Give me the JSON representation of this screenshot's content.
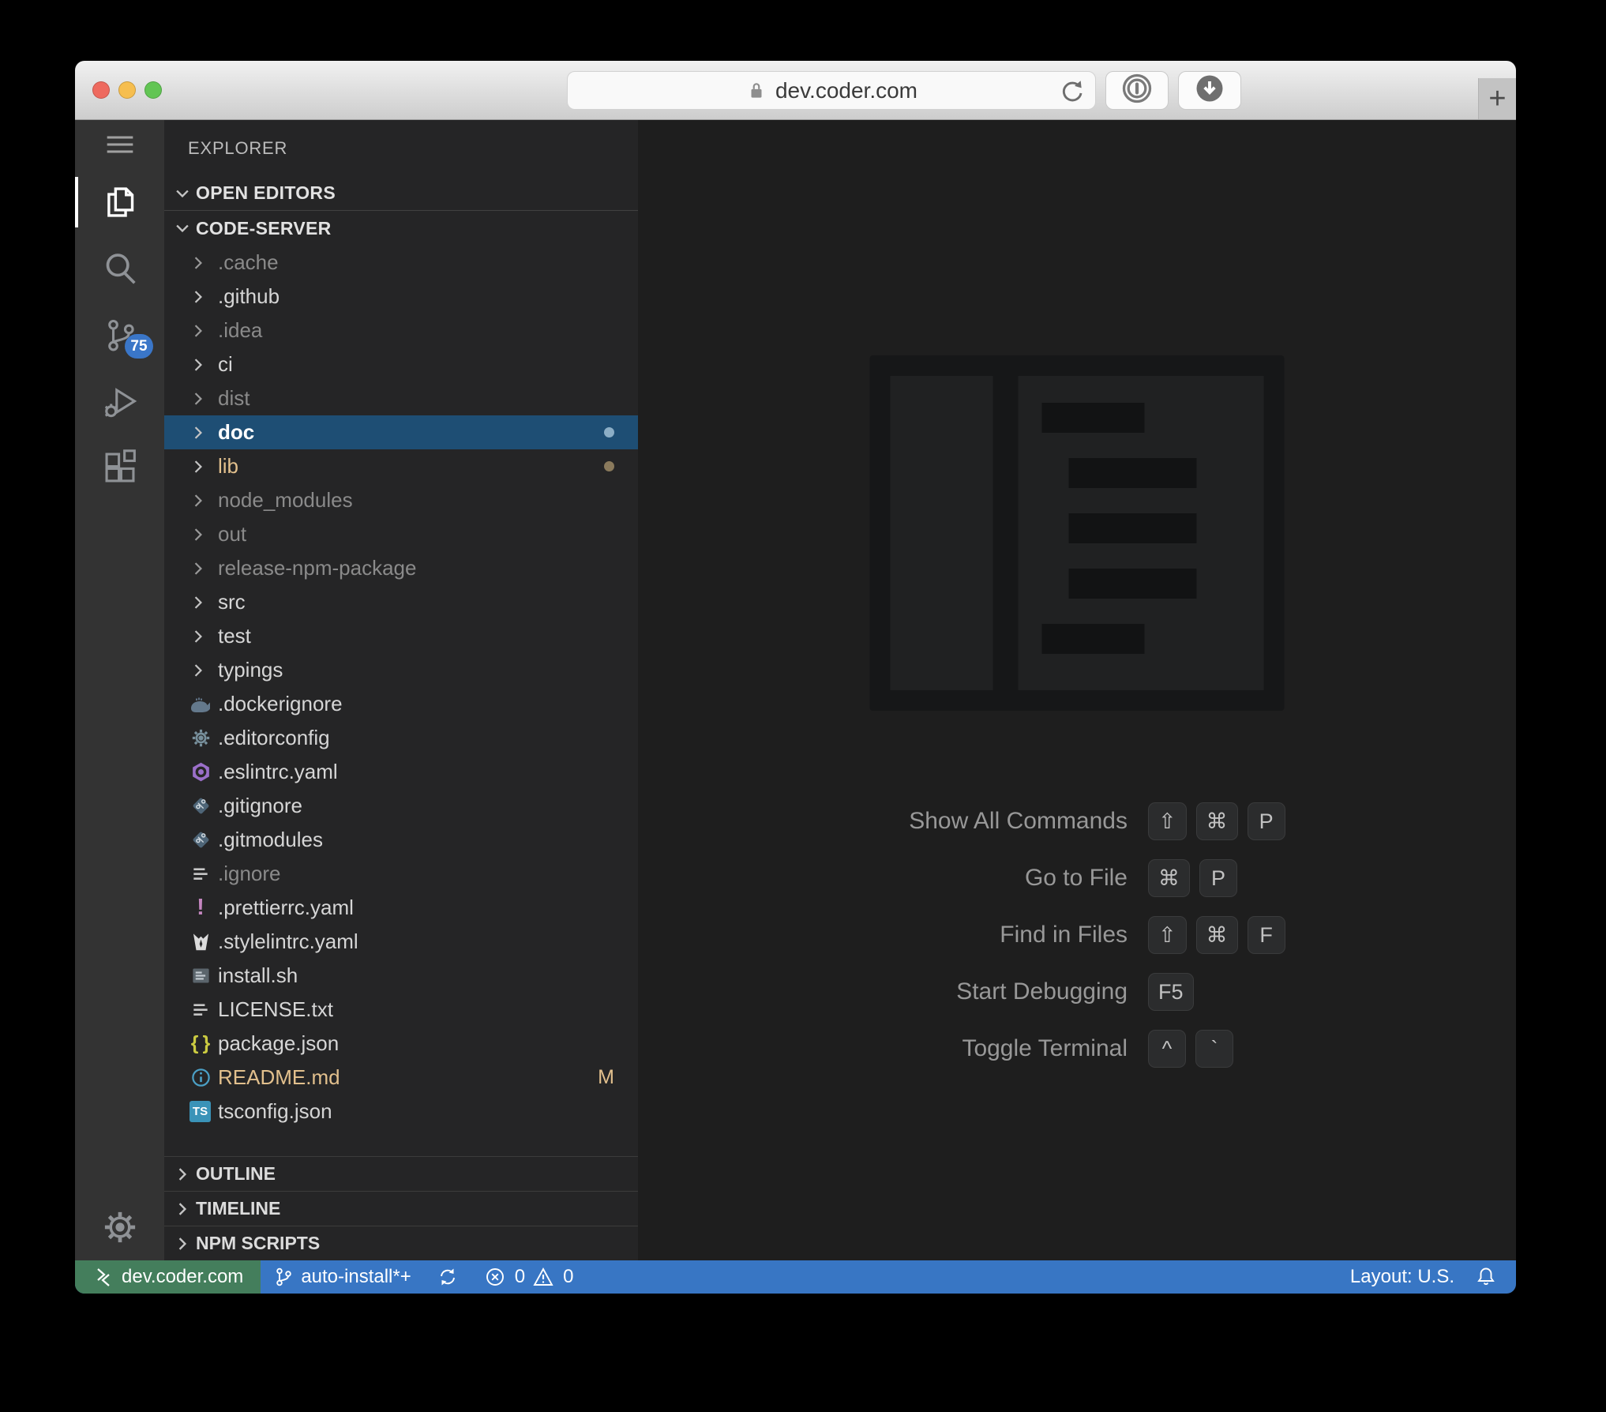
{
  "browser": {
    "url": "dev.coder.com",
    "new_tab_label": "+",
    "traffic_lights": [
      "close",
      "minimize",
      "zoom"
    ],
    "icons": {
      "lock-icon": "padlock",
      "reload-icon": "circular-arrow",
      "onepassword-icon": "1password-keyhole",
      "download-icon": "down-arrow-in-circle",
      "new-tab-icon": "plus"
    }
  },
  "activity_bar": {
    "scm_badge": "75",
    "icons": [
      "menu-icon",
      "files-icon",
      "search-icon",
      "source-control-icon",
      "debug-icon",
      "extensions-icon",
      "gear-icon"
    ]
  },
  "explorer": {
    "title": "EXPLORER",
    "open_editors_label": "OPEN EDITORS",
    "root_label": "CODE-SERVER",
    "items": [
      {
        "name": ".cache",
        "type": "folder",
        "state": "ignored"
      },
      {
        "name": ".github",
        "type": "folder",
        "state": "normal"
      },
      {
        "name": ".idea",
        "type": "folder",
        "state": "ignored"
      },
      {
        "name": "ci",
        "type": "folder",
        "state": "normal"
      },
      {
        "name": "dist",
        "type": "folder",
        "state": "ignored"
      },
      {
        "name": "doc",
        "type": "folder",
        "state": "selected",
        "dot": "blue-gray"
      },
      {
        "name": "lib",
        "type": "folder",
        "state": "modified",
        "dot": "tan"
      },
      {
        "name": "node_modules",
        "type": "folder",
        "state": "ignored"
      },
      {
        "name": "out",
        "type": "folder",
        "state": "ignored"
      },
      {
        "name": "release-npm-package",
        "type": "folder",
        "state": "ignored"
      },
      {
        "name": "src",
        "type": "folder",
        "state": "normal"
      },
      {
        "name": "test",
        "type": "folder",
        "state": "normal"
      },
      {
        "name": "typings",
        "type": "folder",
        "state": "normal"
      },
      {
        "name": ".dockerignore",
        "type": "file",
        "icon": "docker-whale-icon",
        "state": "normal"
      },
      {
        "name": ".editorconfig",
        "type": "file",
        "icon": "gear-file-icon",
        "state": "normal"
      },
      {
        "name": ".eslintrc.yaml",
        "type": "file",
        "icon": "eslint-icon",
        "state": "normal"
      },
      {
        "name": ".gitignore",
        "type": "file",
        "icon": "git-icon",
        "state": "normal"
      },
      {
        "name": ".gitmodules",
        "type": "file",
        "icon": "git-icon",
        "state": "normal"
      },
      {
        "name": ".ignore",
        "type": "file",
        "icon": "text-lines-icon",
        "state": "ignored"
      },
      {
        "name": ".prettierrc.yaml",
        "type": "file",
        "icon": "prettier-icon",
        "state": "normal"
      },
      {
        "name": ".stylelintrc.yaml",
        "type": "file",
        "icon": "stylelint-icon",
        "state": "normal"
      },
      {
        "name": "install.sh",
        "type": "file",
        "icon": "shell-script-icon",
        "state": "normal"
      },
      {
        "name": "LICENSE.txt",
        "type": "file",
        "icon": "text-lines-icon",
        "state": "normal"
      },
      {
        "name": "package.json",
        "type": "file",
        "icon": "json-braces-icon",
        "state": "normal"
      },
      {
        "name": "README.md",
        "type": "file",
        "icon": "info-icon",
        "state": "modified",
        "badge": "M"
      },
      {
        "name": "tsconfig.json",
        "type": "file",
        "icon": "ts-icon",
        "state": "normal"
      }
    ],
    "sections": [
      {
        "label": "OUTLINE"
      },
      {
        "label": "TIMELINE"
      },
      {
        "label": "NPM SCRIPTS"
      }
    ]
  },
  "editor": {
    "shortcuts": [
      {
        "label": "Show All Commands",
        "keys": [
          "⇧",
          "⌘",
          "P"
        ]
      },
      {
        "label": "Go to File",
        "keys": [
          "⌘",
          "P"
        ]
      },
      {
        "label": "Find in Files",
        "keys": [
          "⇧",
          "⌘",
          "F"
        ]
      },
      {
        "label": "Start Debugging",
        "keys": [
          "F5"
        ]
      },
      {
        "label": "Toggle Terminal",
        "keys": [
          "^",
          "`"
        ]
      }
    ]
  },
  "status_bar": {
    "remote_label": "dev.coder.com",
    "branch_label": "auto-install*+",
    "error_count": "0",
    "warning_count": "0",
    "layout_label": "Layout: U.S.",
    "icons": [
      "remote-icon",
      "branch-icon",
      "sync-icon",
      "error-icon",
      "warning-icon",
      "bell-icon"
    ]
  },
  "colors": {
    "status_bar_blue": "#3876c4",
    "remote_green": "#447e5c",
    "selection_blue": "#1e4e74",
    "badge_blue": "#3a76c8",
    "git_modified_tan": "#e2c08d",
    "sidebar_bg": "#252526",
    "activity_bar_bg": "#333333",
    "editor_bg": "#1e1e1e"
  }
}
